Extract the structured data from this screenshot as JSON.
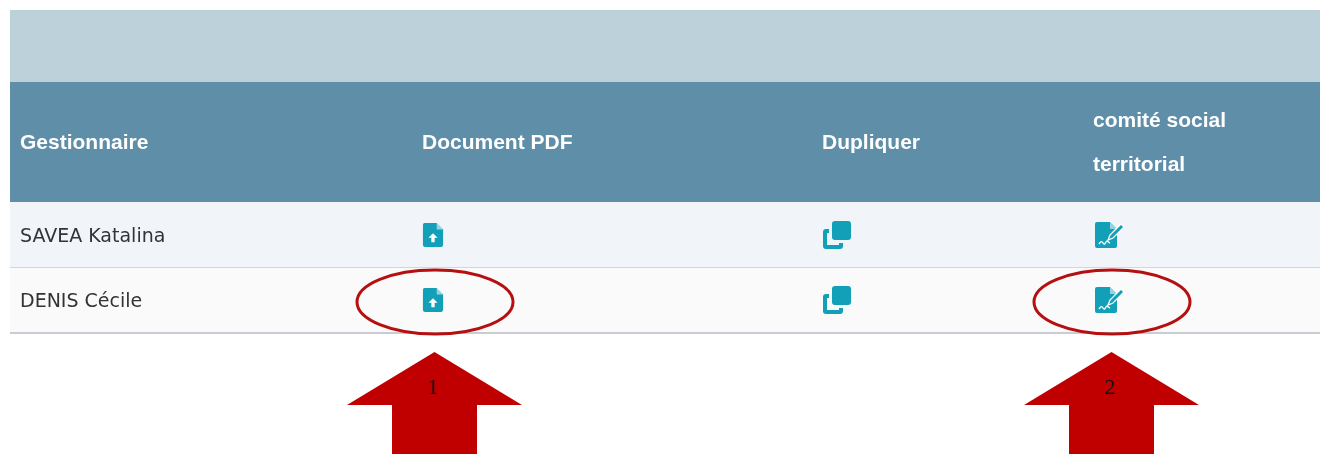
{
  "table": {
    "columns": [
      "Gestionnaire",
      "Document PDF",
      "Dupliquer",
      "comité social territorial"
    ],
    "rows": [
      {
        "cells": [
          {
            "kind": "text",
            "text": "SAVEA Katalina"
          },
          {
            "kind": "upload"
          },
          {
            "kind": "duplicate"
          },
          {
            "kind": "sign"
          }
        ]
      },
      {
        "cells": [
          {
            "kind": "text",
            "text": "DENIS Cécile"
          },
          {
            "kind": "upload",
            "annotation": "1"
          },
          {
            "kind": "duplicate"
          },
          {
            "kind": "sign",
            "annotation": "2"
          }
        ]
      }
    ]
  }
}
